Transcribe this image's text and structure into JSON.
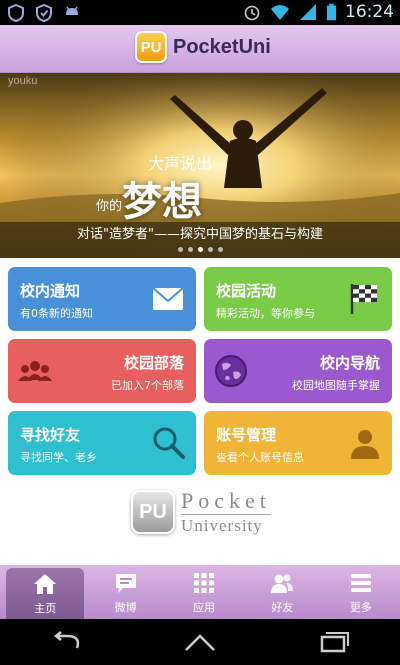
{
  "status_bar": {
    "time": "16:24"
  },
  "app": {
    "badge": "PU",
    "title": "PocketUni"
  },
  "banner": {
    "watermark": "youku",
    "overlay_small": "大声说出",
    "overlay_mid": "你的",
    "overlay_big": "梦想",
    "caption": "对话\"造梦者\"——探究中国梦的基石与构建",
    "pages": 5,
    "active_page": 2
  },
  "tiles": [
    {
      "title": "校内通知",
      "sub": "有0条新的通知",
      "icon": "envelope-icon",
      "color": "#4a90d9"
    },
    {
      "title": "校园活动",
      "sub": "精彩活动，等你参与",
      "icon": "checkered-flag-icon",
      "color": "#7acc48"
    },
    {
      "title": "校园部落",
      "sub": "已加入7个部落",
      "icon": "group-icon",
      "color": "#e85f5f"
    },
    {
      "title": "校内导航",
      "sub": "校园地图随手掌握",
      "icon": "globe-icon",
      "color": "#9b59cf"
    },
    {
      "title": "寻找好友",
      "sub": "寻找同学、老乡",
      "icon": "magnifier-icon",
      "color": "#2ec0cf"
    },
    {
      "title": "账号管理",
      "sub": "查看个人账号信息",
      "icon": "user-icon",
      "color": "#f0b436"
    }
  ],
  "footer_logo": {
    "badge": "PU",
    "line1": "Pocket",
    "line2": "University"
  },
  "bottom_nav": [
    {
      "label": "主页",
      "icon": "home-icon",
      "active": true
    },
    {
      "label": "微博",
      "icon": "chat-bubble-icon",
      "active": false
    },
    {
      "label": "应用",
      "icon": "app-grid-icon",
      "active": false
    },
    {
      "label": "好友",
      "icon": "friends-icon",
      "active": false
    },
    {
      "label": "更多",
      "icon": "menu-icon",
      "active": false
    }
  ]
}
